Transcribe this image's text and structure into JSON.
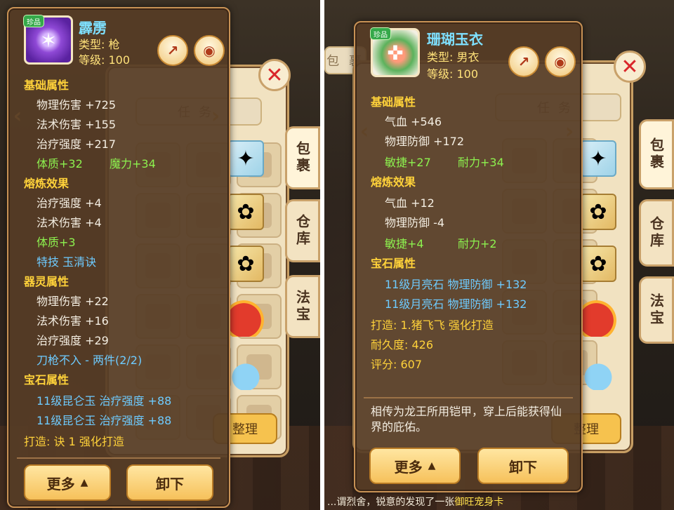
{
  "left": {
    "tabs": {
      "bag": "包裹",
      "warehouse": "仓库",
      "treasure": "法宝"
    },
    "bag_top_tab": "任务",
    "bag_button": "整理",
    "item": {
      "quality_badge": "珍品",
      "name": "霹雳",
      "type_label": "类型: 枪",
      "level_label": "等级: 100"
    },
    "stats": [
      {
        "text": "基础属性",
        "style": "sec"
      },
      {
        "text": "物理伤害 +725",
        "style": "stat"
      },
      {
        "text": "法术伤害 +155",
        "style": "stat"
      },
      {
        "text": "治疗强度 +217",
        "style": "stat"
      },
      {
        "text": "体质+32",
        "style": "green"
      },
      {
        "text": "魔力+34",
        "style": "green"
      },
      {
        "text": "熔炼效果",
        "style": "sec"
      },
      {
        "text": "治疗强度 +4",
        "style": "stat"
      },
      {
        "text": "法术伤害 +4",
        "style": "stat"
      },
      {
        "text": "体质+3",
        "style": "green"
      },
      {
        "text": "特技 玉清诀",
        "style": "cyan"
      },
      {
        "text": "器灵属性",
        "style": "sec"
      },
      {
        "text": "物理伤害 +22",
        "style": "stat"
      },
      {
        "text": "法术伤害 +16",
        "style": "stat"
      },
      {
        "text": "治疗强度 +29",
        "style": "stat"
      },
      {
        "text": "刀枪不入 - 两件(2/2)",
        "style": "cyan"
      },
      {
        "text": "宝石属性",
        "style": "sec"
      },
      {
        "text": "11级昆仑玉 治疗强度 +88",
        "style": "cyan"
      },
      {
        "text": "11级昆仑玉 治疗强度 +88",
        "style": "cyan"
      },
      {
        "text": "打造: 诀 1  强化打造",
        "style": "yellow"
      }
    ],
    "buttons": {
      "more": "更多",
      "unequip": "卸下"
    }
  },
  "right": {
    "tabs": {
      "bag": "包裹",
      "warehouse": "仓库",
      "treasure": "法宝"
    },
    "bag_top_tab": "任务",
    "bag_top_left": "包 裹",
    "bag_button": "整理",
    "item": {
      "quality_badge": "珍品",
      "name": "珊瑚玉衣",
      "type_label": "类型: 男衣",
      "level_label": "等级: 100"
    },
    "stats": [
      {
        "text": "基础属性",
        "style": "sec"
      },
      {
        "text": "气血 +546",
        "style": "stat"
      },
      {
        "text": "物理防御 +172",
        "style": "stat"
      },
      {
        "text": "敏捷+27",
        "style": "green"
      },
      {
        "text": "耐力+34",
        "style": "green"
      },
      {
        "text": "熔炼效果",
        "style": "sec"
      },
      {
        "text": "气血 +12",
        "style": "stat"
      },
      {
        "text": "物理防御 -4",
        "style": "stat"
      },
      {
        "text": "敏捷+4",
        "style": "green"
      },
      {
        "text": "耐力+2",
        "style": "green"
      },
      {
        "text": "宝石属性",
        "style": "sec"
      },
      {
        "text": "11级月亮石 物理防御 +132",
        "style": "cyan"
      },
      {
        "text": "11级月亮石 物理防御 +132",
        "style": "cyan"
      },
      {
        "text": "打造: 1.猪飞飞  强化打造",
        "style": "yellow"
      },
      {
        "text": "耐久度: 426",
        "style": "yellow"
      },
      {
        "text": "评分: 607",
        "style": "yellow"
      }
    ],
    "description": "相传为龙王所用铠甲，穿上后能获得仙界的庇佑。",
    "buttons": {
      "more": "更多",
      "unequip": "卸下"
    },
    "ticker_prefix": "...谓烈舍，锐意的发现了一张",
    "ticker_highlight": "御旺宠身卡"
  }
}
